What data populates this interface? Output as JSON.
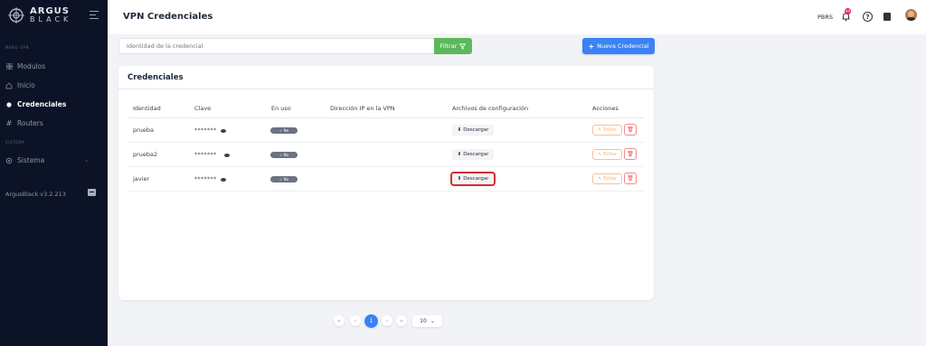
{
  "app": {
    "logo_line1": "ARGUS",
    "logo_line2": "BLACK",
    "version": "ArgusBlack v3.2.213"
  },
  "sidebar": {
    "section_menu": "MENU VPN",
    "section_system": "SISTEMA",
    "items": [
      {
        "label": "Modulos",
        "icon": "grid-icon"
      },
      {
        "label": "Inicio",
        "icon": "home-icon"
      },
      {
        "label": "Credenciales",
        "icon": "dot-icon",
        "active": true
      },
      {
        "label": "Routers",
        "icon": "hash-icon"
      },
      {
        "label": "Sistema",
        "icon": "gear-icon"
      }
    ]
  },
  "header": {
    "title": "VPN Credenciales",
    "user_code": "PBRS",
    "notification_count": "99"
  },
  "toolbar": {
    "search_placeholder": "Identidad de la credencial",
    "filter_label": "Filtrar",
    "new_label": "Nueva Credencial"
  },
  "card": {
    "title": "Credenciales",
    "columns": [
      "Identidad",
      "Clave",
      "En uso",
      "Dirección IP en la VPN",
      "Archivos de configuración",
      "Acciones"
    ],
    "rows": [
      {
        "identity": "prueba",
        "password": "*******",
        "in_use": "✓ No",
        "ip": "",
        "download": "Descargar",
        "edit": "Editar"
      },
      {
        "identity": "prueba2",
        "password": "*******",
        "in_use": "✓ No",
        "ip": "",
        "download": "Descargar",
        "edit": "Editar"
      },
      {
        "identity": "javier",
        "password": "*******",
        "in_use": "✓ No",
        "ip": "",
        "download": "Descargar",
        "edit": "Editar"
      }
    ]
  },
  "pagination": {
    "first": "«",
    "prev": "‹",
    "current": "1",
    "next": "›",
    "last": "»",
    "page_size": "10"
  },
  "colors": {
    "sidebar_bg": "#0d1326",
    "primary": "#3b82f6",
    "filter_green": "#5cb85c",
    "highlight_red": "#d32f2f"
  }
}
